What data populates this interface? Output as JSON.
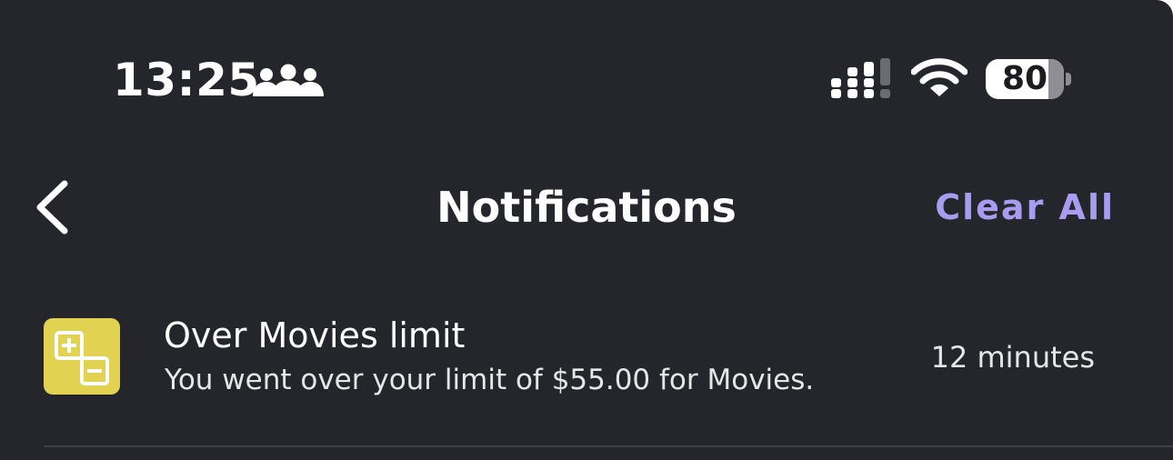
{
  "status_bar": {
    "time": "13:25",
    "focus_icon": "people-icon",
    "signal_icon": "cellular-signal-icon",
    "wifi_icon": "wifi-icon",
    "battery_level": "80",
    "battery_fraction": 0.8
  },
  "nav": {
    "back_icon": "chevron-left-icon",
    "title": "Notifications",
    "clear_all_label": "Clear All"
  },
  "notifications": [
    {
      "icon": "budget-plus-minus-icon",
      "title": "Over Movies limit",
      "message": "You went over your limit of $55.00 for Movies.",
      "time": "12 minutes"
    }
  ],
  "colors": {
    "background": "#24262b",
    "accent": "#a99cf0",
    "icon_tile": "#e2d252",
    "text_primary": "#ffffff",
    "text_secondary": "#e6e6e8",
    "divider": "#3e4046"
  }
}
